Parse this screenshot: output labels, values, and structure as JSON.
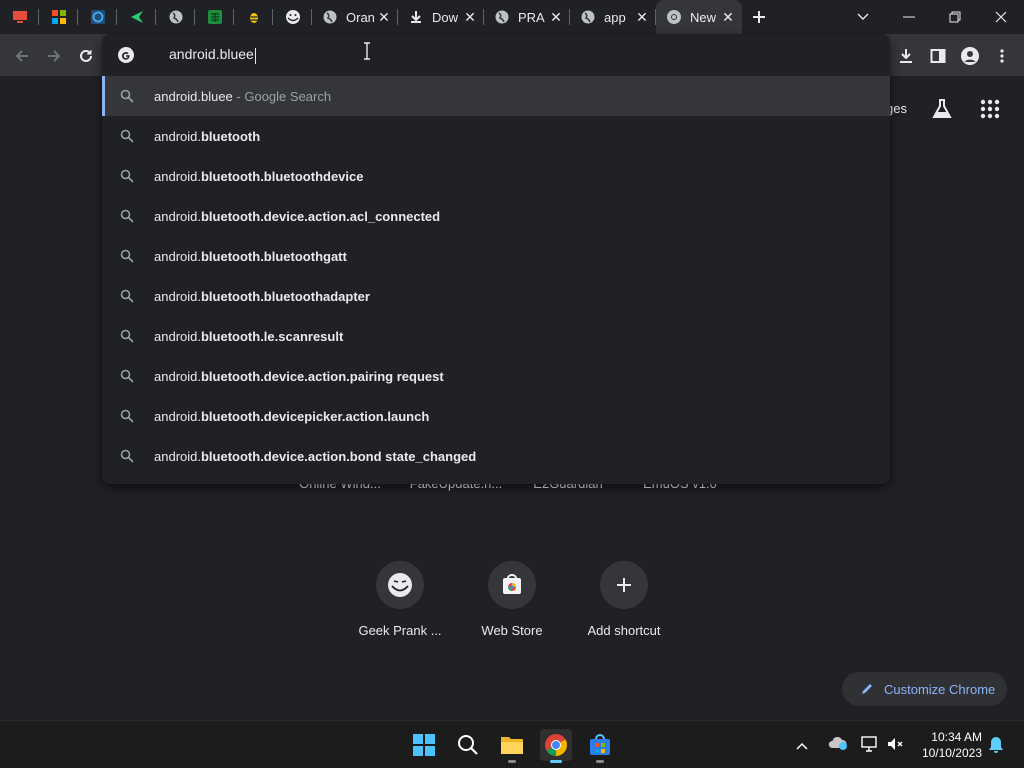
{
  "tabs": {
    "pinned": [
      {
        "icon": "monitor-icon",
        "color": "#e44c3c"
      },
      {
        "icon": "windows-xp-icon",
        "color": "#f5a623"
      },
      {
        "icon": "aperture-icon",
        "color": "#4aa3df"
      },
      {
        "icon": "arrow-flag-icon",
        "color": "#2ecc71"
      },
      {
        "icon": "globe-icon",
        "color": "#e8eaed"
      },
      {
        "icon": "spreadsheet-icon",
        "color": "#2ecc71"
      },
      {
        "icon": "bee-icon",
        "color": "#f1c40f"
      },
      {
        "icon": "trollface-icon",
        "color": "#e8eaed"
      }
    ],
    "items": [
      {
        "title": "Oran",
        "icon": "globe-icon"
      },
      {
        "title": "Dow",
        "icon": "download-icon"
      },
      {
        "title": "PRA",
        "icon": "globe-icon"
      },
      {
        "title": "app",
        "icon": "globe-icon"
      },
      {
        "title": "New",
        "icon": "chrome-icon",
        "active": true
      }
    ],
    "close_glyph": "✕"
  },
  "omnibox": {
    "value": "android.bluee",
    "suggestions": [
      {
        "typed": "android.bluee",
        "rest": "",
        "hint": "- Google Search"
      },
      {
        "typed": "android.",
        "rest": "bluetooth",
        "hint": ""
      },
      {
        "typed": "android.",
        "rest": "bluetooth.bluetoothdevice",
        "hint": ""
      },
      {
        "typed": "android.",
        "rest": "bluetooth.device.action.acl_connected",
        "hint": ""
      },
      {
        "typed": "android.",
        "rest": "bluetooth.bluetoothgatt",
        "hint": ""
      },
      {
        "typed": "android.",
        "rest": "bluetooth.bluetoothadapter",
        "hint": ""
      },
      {
        "typed": "android.",
        "rest": "bluetooth.le.scanresult",
        "hint": ""
      },
      {
        "typed": "android.",
        "rest": "bluetooth.device.action.pairing request",
        "hint": ""
      },
      {
        "typed": "android.",
        "rest": "bluetooth.devicepicker.action.launch",
        "hint": ""
      },
      {
        "typed": "android.",
        "rest": "bluetooth.device.action.bond state_changed",
        "hint": ""
      }
    ]
  },
  "page": {
    "header_link": "ges",
    "shortcuts_row1": [
      "Online Wind...",
      "FakeUpdate.n...",
      "E2Guardian",
      "EmuOS v1.0"
    ],
    "shortcuts_row2": [
      "Geek Prank ...",
      "Web Store",
      "Add shortcut"
    ],
    "customize_label": "Customize Chrome"
  },
  "taskbar": {
    "time": "10:34 AM",
    "date": "10/10/2023"
  },
  "colors": {
    "accent": "#8ab4f8",
    "taskbar_active": "#60cdff"
  }
}
